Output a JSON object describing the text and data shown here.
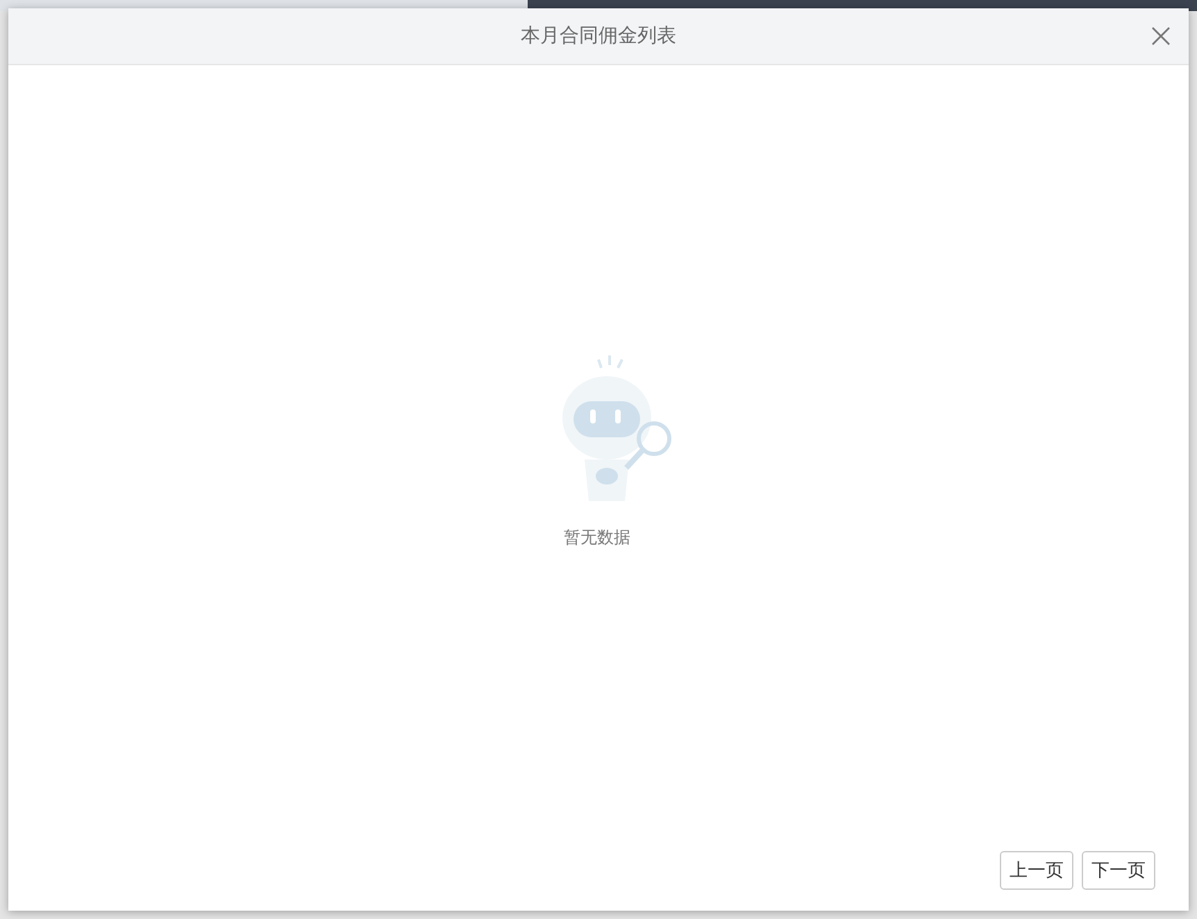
{
  "dialog": {
    "title": "本月合同佣金列表"
  },
  "empty_state": {
    "message": "暂无数据"
  },
  "pagination": [
    {
      "label": "上一页"
    },
    {
      "label": "下一页"
    }
  ]
}
